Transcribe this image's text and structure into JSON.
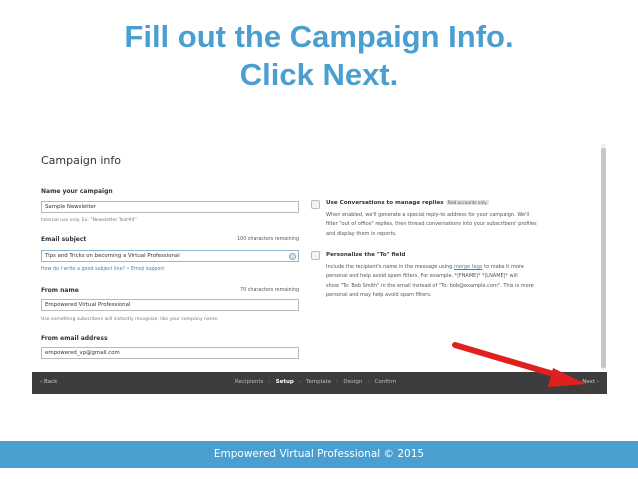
{
  "slide": {
    "title_line1": "Fill out the Campaign Info.",
    "title_line2": "Click Next.",
    "footer_text": "Empowered Virtual Professional © 2015"
  },
  "form": {
    "heading": "Campaign info",
    "campaign_name": {
      "label": "Name your campaign",
      "value": "Sample Newsletter",
      "hint": "Internal use only. Ex: \"Newsletter Test#4\""
    },
    "email_subject": {
      "label": "Email subject",
      "remaining": "100 characters remaining",
      "value": "Tips and Tricks on becoming a Virtual Professional",
      "link_subject_help": "How do I write a good subject line?",
      "link_separator": "•",
      "link_emoji": "Emoji support"
    },
    "from_name": {
      "label": "From name",
      "remaining": "70 characters remaining",
      "value": "Empowered Virtual Professional",
      "hint": "Use something subscribers will instantly recognize, like your company name."
    },
    "from_email": {
      "label": "From email address",
      "value": "empowered_vp@gmail.com"
    }
  },
  "options": {
    "conversations": {
      "title": "Use Conversations to manage replies",
      "badge": "Paid accounts only",
      "desc_line1": "When enabled, we'll generate a special reply-to address for your campaign. We'll",
      "desc_line2": "filter \"out of office\" replies, then thread conversations into your subscribers' profiles",
      "desc_line3": "and display them in reports."
    },
    "personalize": {
      "title": "Personalize the \"To\" field",
      "desc_line1_pre": "Include the recipient's name in the message using ",
      "desc_line1_link": "merge tags",
      "desc_line1_post": " to make it more",
      "desc_line2": "personal and help avoid spam filters. For example, *|FNAME|* *|LNAME|* will",
      "desc_line3": "show \"To: Bob Smith\" in the email instead of \"To: bob@example.com\". This is more",
      "desc_line4": "personal and may help avoid spam filters."
    }
  },
  "footer_nav": {
    "back": "‹ Back",
    "steps": [
      "Recipients",
      "Setup",
      "Template",
      "Design",
      "Confirm"
    ],
    "active_step": "Setup",
    "next": "Next ›"
  },
  "colors": {
    "slide_blue": "#4a9fd0",
    "footer_dark": "#3d3d3d",
    "arrow_red": "#e0201f",
    "link_blue": "#3a86b8"
  },
  "icons": {
    "emoji_button": "smiley-icon",
    "annotation": "red-arrow-icon"
  }
}
